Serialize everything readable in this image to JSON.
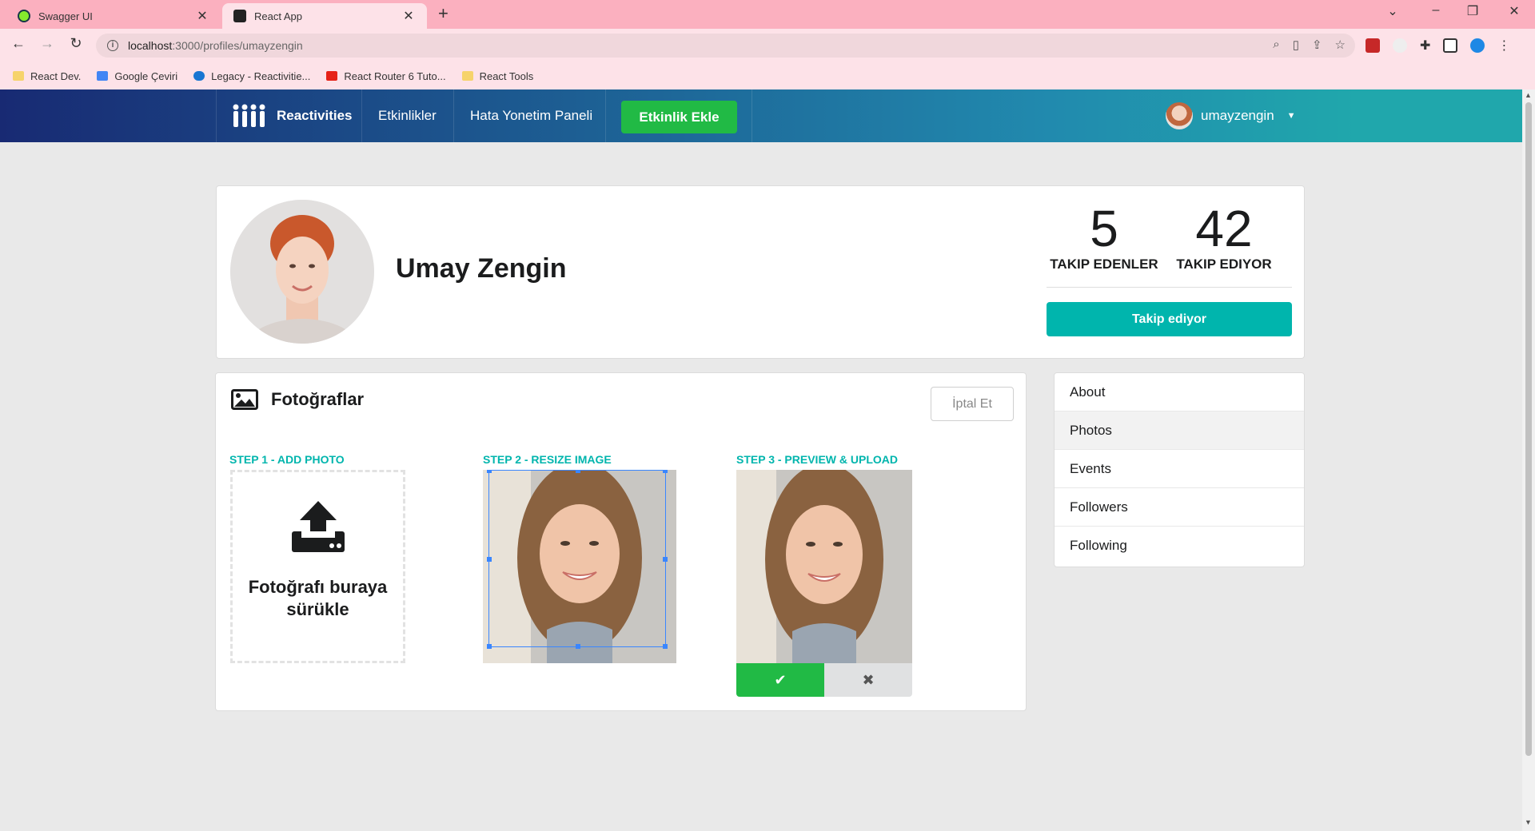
{
  "browser": {
    "tabs": [
      {
        "title": "Swagger UI",
        "active": false,
        "favicon_color": "#85ea2d"
      },
      {
        "title": "React App",
        "active": true,
        "favicon_color": "#222222"
      }
    ],
    "url_host": "localhost",
    "url_path": ":3000/profiles/umayzengin",
    "bookmarks": [
      {
        "label": "React Dev.",
        "icon": "folder-icon"
      },
      {
        "label": "Google Çeviri",
        "icon": "google-translate-icon"
      },
      {
        "label": "Legacy - Reactivitie...",
        "icon": "cloud-icon"
      },
      {
        "label": "React Router 6 Tuto...",
        "icon": "youtube-icon"
      },
      {
        "label": "React Tools",
        "icon": "folder-icon"
      }
    ]
  },
  "nav": {
    "brand": "Reactivities",
    "activities": "Etkinlikler",
    "errors": "Hata Yonetim Paneli",
    "create": "Etkinlik Ekle",
    "username": "umayzengin"
  },
  "profile": {
    "display_name": "Umay Zengin",
    "followers_count": "5",
    "followers_label": "TAKIP EDENLER",
    "following_count": "42",
    "following_label": "TAKIP EDIYOR",
    "follow_button": "Takip ediyor"
  },
  "photos": {
    "title": "Fotoğraflar",
    "cancel": "İptal Et",
    "step1": "STEP 1 - ADD PHOTO",
    "step2": "STEP 2 - RESIZE IMAGE",
    "step3": "STEP 3 - PREVIEW & UPLOAD",
    "drop_line1": "Fotoğrafı buraya",
    "drop_line2": "sürükle"
  },
  "menu": {
    "items": [
      "About",
      "Photos",
      "Events",
      "Followers",
      "Following"
    ],
    "active": "Photos"
  },
  "colors": {
    "teal": "#00b5ad",
    "green": "#21ba45",
    "nav_start": "#182a73",
    "nav_end": "#20a7ac"
  }
}
